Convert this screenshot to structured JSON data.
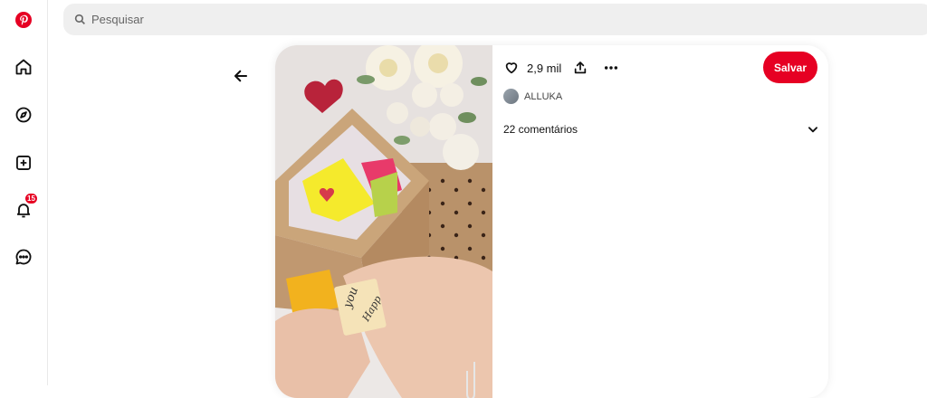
{
  "search": {
    "placeholder": "Pesquisar"
  },
  "sidebar": {
    "items": [
      {
        "name": "pinterest-logo"
      },
      {
        "name": "home"
      },
      {
        "name": "explore"
      },
      {
        "name": "create"
      },
      {
        "name": "notifications",
        "badge": "15"
      },
      {
        "name": "messages"
      }
    ]
  },
  "pin": {
    "reactions": "2,9 mil",
    "save_label": "Salvar",
    "author": "ALLUKA",
    "comments_label": "22 comentários",
    "image_text": [
      "you",
      "Happ"
    ]
  },
  "colors": {
    "accent": "#e60023",
    "search_bg": "#efefef"
  }
}
